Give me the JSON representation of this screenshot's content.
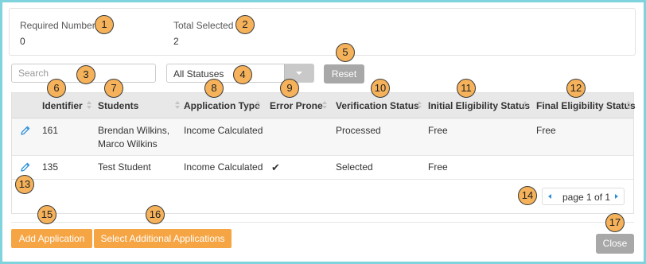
{
  "summary": {
    "required_label": "Required Number",
    "required_value": "0",
    "total_label": "Total Selected",
    "total_value": "2"
  },
  "filters": {
    "search_placeholder": "Search",
    "status_selected": "All Statuses",
    "reset_label": "Reset"
  },
  "table": {
    "columns": [
      "Identifier",
      "Students",
      "Application Type",
      "Error Prone",
      "Verification Status",
      "Initial Eligibility Status",
      "Final Eligibility Status"
    ],
    "rows": [
      {
        "identifier": "161",
        "student_line1": "Brendan Wilkins,",
        "student_line2": "Marco Wilkins",
        "type": "Income Calculated",
        "error_prone": "",
        "verification": "Processed",
        "initial": "Free",
        "final": "Free"
      },
      {
        "identifier": "135",
        "student_line1": "Test Student",
        "student_line2": "",
        "type": "Income Calculated",
        "error_prone": "✔",
        "verification": "Selected",
        "initial": "Free",
        "final": ""
      }
    ]
  },
  "pager": {
    "text": "page 1 of 1"
  },
  "actions": {
    "add_label": "Add Application",
    "select_additional_label": "Select Additional Applications",
    "close_label": "Close"
  },
  "callouts": [
    "1",
    "2",
    "3",
    "4",
    "5",
    "6",
    "7",
    "8",
    "9",
    "10",
    "11",
    "12",
    "13",
    "14",
    "15",
    "16",
    "17"
  ],
  "colors": {
    "accent_orange": "#f6a544",
    "callout": "#f5b25a",
    "link_blue": "#2a8fd6",
    "frame": "#7fd3dc"
  }
}
